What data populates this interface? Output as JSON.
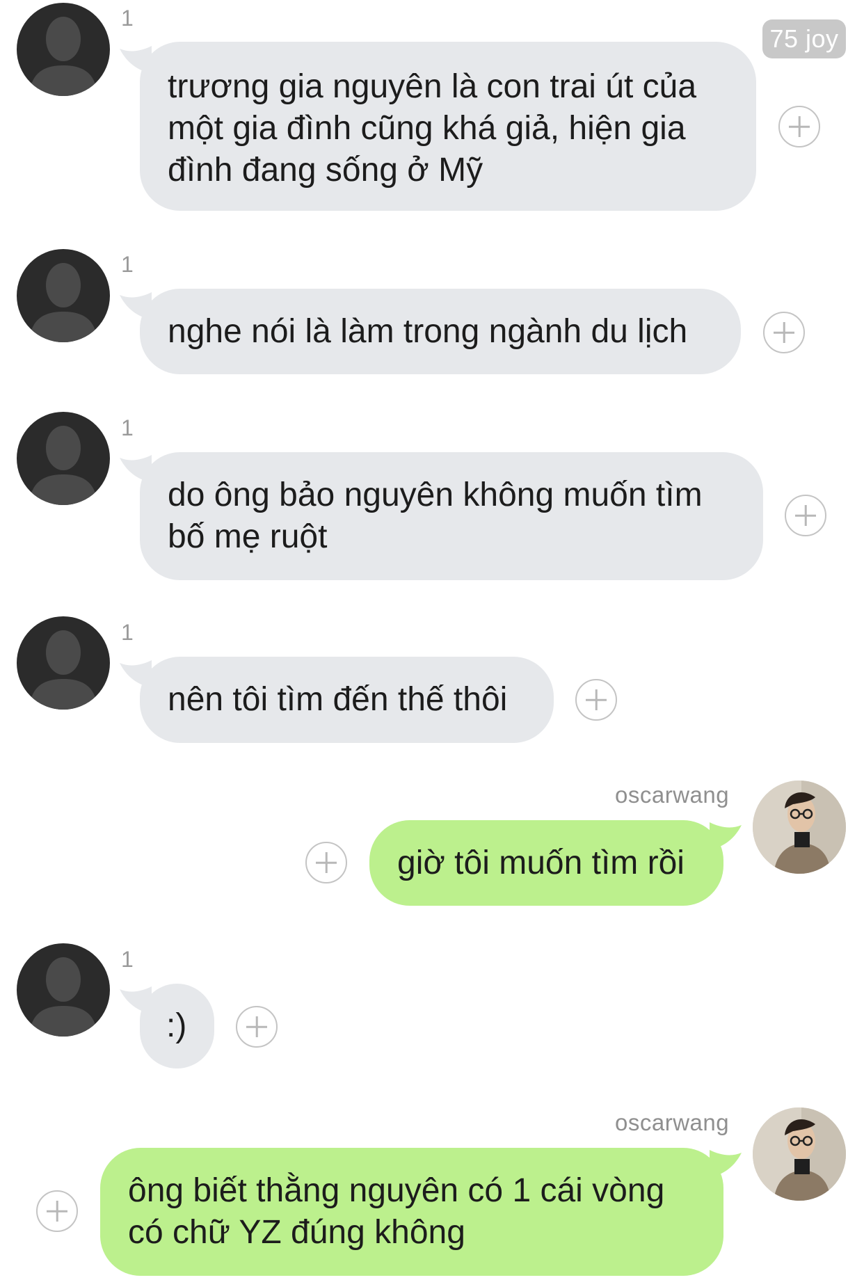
{
  "badge": {
    "label": "75 joy"
  },
  "contact": {
    "read_count": "1"
  },
  "me": {
    "name": "oscarwang"
  },
  "messages": [
    {
      "from": "contact",
      "read_count": "1",
      "text": "trương gia nguyên là con trai út của\nmột gia đình cũng khá giả, hiện gia\nđình đang sống ở Mỹ"
    },
    {
      "from": "contact",
      "read_count": "1",
      "text": "nghe nói là làm trong ngành du lịch"
    },
    {
      "from": "contact",
      "read_count": "1",
      "text": "do ông bảo nguyên không muốn tìm\nbố mẹ ruột"
    },
    {
      "from": "contact",
      "read_count": "1",
      "text": "nên tôi tìm đến thế thôi"
    },
    {
      "from": "me",
      "name": "oscarwang",
      "text": "giờ tôi muốn tìm rồi"
    },
    {
      "from": "contact",
      "read_count": "1",
      "text": ":)"
    },
    {
      "from": "me",
      "name": "oscarwang",
      "text": "ông biết thằng nguyên có 1 cái vòng\ncó chữ YZ đúng không"
    }
  ],
  "colors": {
    "incoming_bubble": "#e6e8eb",
    "outgoing_bubble": "#bcf08d",
    "background": "#ffffff",
    "badge": "#c8c8c8"
  },
  "icons": {
    "default_avatar": "person-silhouette-icon",
    "action": "plus-circle-icon"
  }
}
